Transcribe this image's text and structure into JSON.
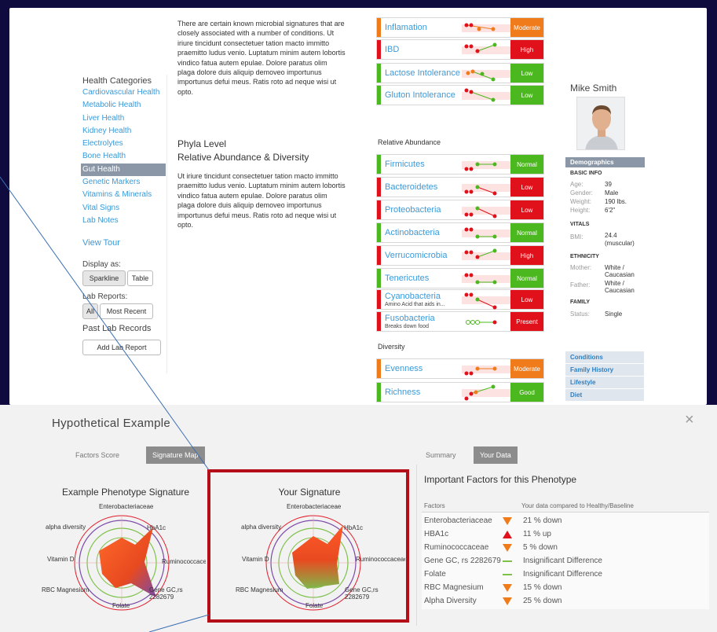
{
  "sidebar": {
    "title": "Health Categories",
    "items": [
      "Cardiovascular Health",
      "Metabolic Health",
      "Liver Health",
      "Kidney Health",
      "Electrolytes",
      "Bone Health",
      "Gut Health",
      "Genetic Markers",
      "Vitamins & Minerals",
      "Vital Signs",
      "Lab Notes"
    ],
    "view_tour": "View Tour",
    "display_as_label": "Display as:",
    "display_options": [
      "Sparkline",
      "Table"
    ],
    "lab_reports_label": "Lab Reports:",
    "lab_report_options": [
      "All",
      "Most Recent"
    ],
    "past_records_label": "Past Lab Records",
    "add_report_button": "Add Lab Report"
  },
  "intro": {
    "paragraph1": "There are certain known microbial signatures that are closely associated with a number of conditions. Ut iriure tincidunt consectetuer tation macto immitto praemitto ludus venio. Luptatum minim autem lobortis vindico fatua autem epulae. Dolore paratus olim plaga dolore duis aliquip demoveo importunus importunus defui meus. Ratis roto ad neque wisi ut opto.",
    "phyla_title_line1": "Phyla Level",
    "phyla_title_line2": "Relative Abundance & Diversity",
    "paragraph2": "Ut iriure tincidunt consectetuer tation macto immitto praemitto ludus venio. Luptatum minim autem lobortis vindico fatua autem epulae. Dolore paratus olim plaga dolore duis aliquip demoveo importunus importunus defui meus. Ratis roto ad neque wisi ut opto."
  },
  "conditions": [
    {
      "name": "Inflamation",
      "status": "Moderate",
      "color": "#f07b1b"
    },
    {
      "name": "IBD",
      "status": "High",
      "color": "#e0111b"
    },
    {
      "name": "Lactose Intolerance",
      "status": "Low",
      "color": "#4cb81f"
    },
    {
      "name": "Gluton Intolerance",
      "status": "Low",
      "color": "#4cb81f"
    }
  ],
  "relative_abundance_label": "Relative Abundance",
  "phyla": [
    {
      "name": "Firmicutes",
      "sub": "",
      "status": "Normal",
      "color": "#4cb81f"
    },
    {
      "name": "Bacteroidetes",
      "sub": "",
      "status": "Low",
      "color": "#e0111b"
    },
    {
      "name": "Proteobacteria",
      "sub": "",
      "status": "Low",
      "color": "#e0111b"
    },
    {
      "name": "Actinobacteria",
      "sub": "",
      "status": "Normal",
      "color": "#4cb81f"
    },
    {
      "name": "Verrucomicrobia",
      "sub": "",
      "status": "High",
      "color": "#e0111b"
    },
    {
      "name": "Tenericutes",
      "sub": "",
      "status": "Normal",
      "color": "#4cb81f"
    },
    {
      "name": "Cyanobacteria",
      "sub": "Amino Acid that aids in...",
      "status": "Low",
      "color": "#e0111b"
    },
    {
      "name": "Fusobacteria",
      "sub": "Breaks down food",
      "status": "Present",
      "color": "#e0111b"
    }
  ],
  "diversity_label": "Diversity",
  "diversity": [
    {
      "name": "Evenness",
      "status": "Moderate",
      "color": "#f07b1b"
    },
    {
      "name": "Richness",
      "status": "Good",
      "color": "#4cb81f"
    }
  ],
  "profile": {
    "name": "Mike Smith",
    "demographics_header": "Demographics",
    "basic_info": "BASIC INFO",
    "age_k": "Age:",
    "age_v": "39",
    "gender_k": "Gender:",
    "gender_v": "Male",
    "weight_k": "Weight:",
    "weight_v": "190 lbs.",
    "height_k": "Height:",
    "height_v": "6'2\"",
    "vitals": "VITALS",
    "bmi_k": "BMI:",
    "bmi_v1": "24.4",
    "bmi_v2": "(muscular)",
    "ethnicity": "ETHNICITY",
    "mother_k": "Mother:",
    "mother_v1": "White /",
    "mother_v2": "Caucasian",
    "father_k": "Father:",
    "father_v1": "White /",
    "father_v2": "Caucasian",
    "family": "FAMILY",
    "status_k": "Status:",
    "status_v": "Single",
    "links": [
      "Conditions",
      "Family History",
      "Lifestyle",
      "Diet"
    ]
  },
  "modal": {
    "title": "Hypothetical Example",
    "close": "×",
    "left_tabs": [
      "Factors Score",
      "Signature Map"
    ],
    "right_tabs": [
      "Summary",
      "Your Data"
    ],
    "radar1_title": "Example Phenotype Signature",
    "radar2_title": "Your Signature",
    "axes": [
      "Enterobacteriaceae",
      "HbA1c",
      "Ruminococcaceae",
      "Gene GC,rs",
      "2282679",
      "Folate",
      "RBC Magnesium",
      "Vitamin D",
      "alpha diversity"
    ],
    "factors_title": "Important Factors for this Phenotype",
    "col_factors": "Factors",
    "col_compare": "Your data compared to Healthy/Baseline",
    "factors": [
      {
        "name": "Enterobacteriaceae",
        "dir": "down",
        "text": "21 % down"
      },
      {
        "name": "HBA1c",
        "dir": "up",
        "text": "11 % up"
      },
      {
        "name": "Ruminococcaceae",
        "dir": "down",
        "text": "5 % down"
      },
      {
        "name": "Gene GC, rs 2282679",
        "dir": "flat",
        "text": "Insignificant Difference"
      },
      {
        "name": "Folate",
        "dir": "flat",
        "text": "Insignificant Difference"
      },
      {
        "name": "RBC Magnesium",
        "dir": "down",
        "text": "15 % down"
      },
      {
        "name": "Alpha Diversity",
        "dir": "down",
        "text": "25 % down"
      }
    ]
  }
}
